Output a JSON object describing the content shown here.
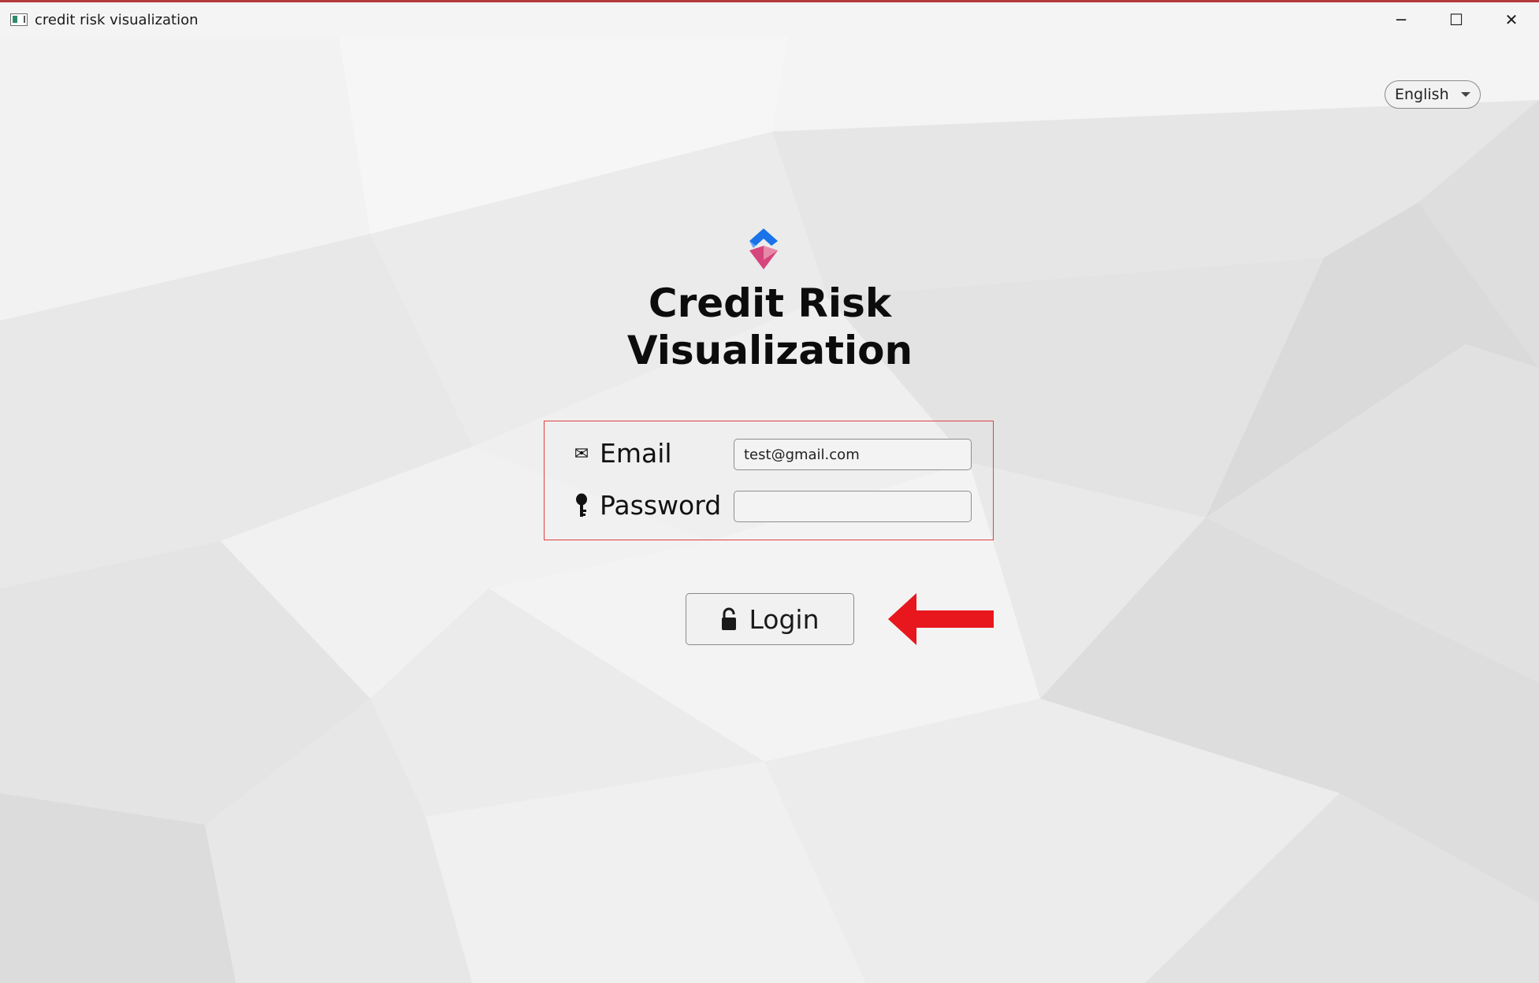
{
  "window": {
    "title": "credit risk visualization",
    "controls": {
      "minimize_glyph": "─",
      "maximize_glyph": "☐",
      "close_glyph": "✕"
    }
  },
  "language": {
    "selected": "English"
  },
  "app": {
    "title_line1": "Credit Risk",
    "title_line2": "Visualization"
  },
  "form": {
    "email": {
      "label": "Email",
      "icon": "envelope-icon",
      "icon_glyph": "✉",
      "value": "test@gmail.com"
    },
    "password": {
      "label": "Password",
      "icon": "key-icon",
      "value": ""
    }
  },
  "login": {
    "label": "Login",
    "icon": "unlocked-padlock-icon"
  },
  "colors": {
    "form_border": "#e04040",
    "arrow": "#e8171d",
    "logo_blue": "#1a73e8",
    "logo_pink": "#d6457c"
  }
}
